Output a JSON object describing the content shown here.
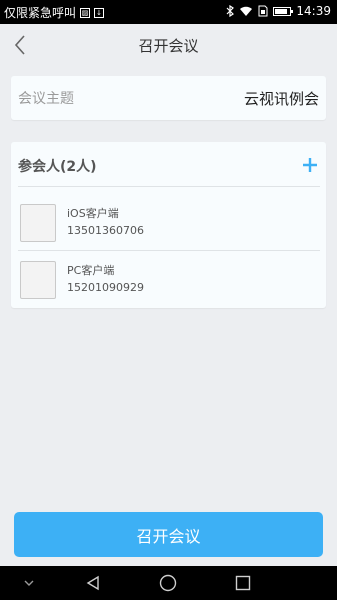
{
  "status_bar": {
    "carrier_text": "仅限紧急呼叫",
    "time": "14:39",
    "icons": [
      "image-icon",
      "download-icon",
      "bluetooth-icon",
      "wifi-icon",
      "sim-icon",
      "battery-icon"
    ],
    "battery_level": 0.85
  },
  "header": {
    "title": "召开会议",
    "back_icon": "chevron-left-icon"
  },
  "topic": {
    "label": "会议主题",
    "value": "云视讯例会"
  },
  "participants": {
    "title": "参会人(2人)",
    "add_icon": "plus-icon",
    "members": [
      {
        "name": "iOS客户端",
        "phone": "13501360706"
      },
      {
        "name": "PC客户端",
        "phone": "15201090929"
      }
    ]
  },
  "actions": {
    "start_label": "召开会议"
  },
  "nav_bar": {
    "icons": [
      "chevron-down-icon",
      "back-triangle-icon",
      "home-circle-icon",
      "recents-square-icon"
    ]
  },
  "colors": {
    "accent": "#3db0f5",
    "background": "#eceef1",
    "card": "#f8fcfe"
  }
}
